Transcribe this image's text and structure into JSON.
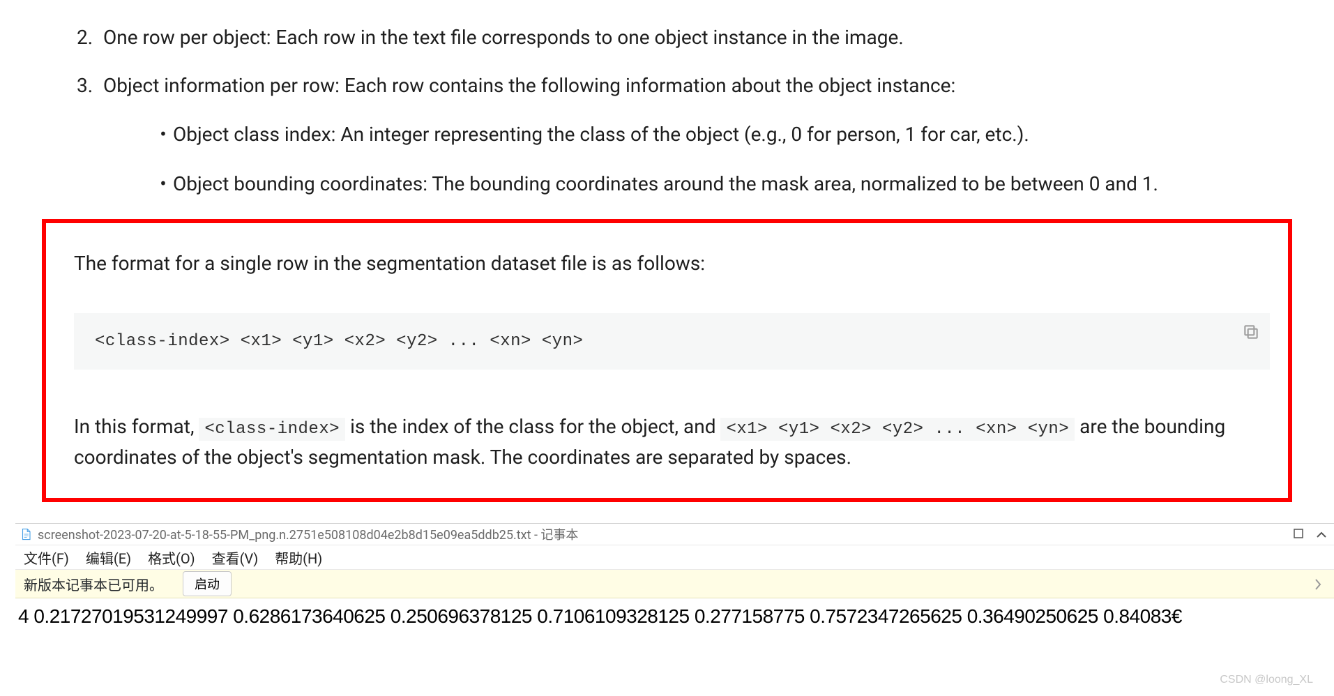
{
  "doc": {
    "list2_num": "2.",
    "list2_text": "One row per object: Each row in the text file corresponds to one object instance in the image.",
    "list3_num": "3.",
    "list3_text": "Object information per row: Each row contains the following information about the object instance:",
    "bullet1": "Object class index: An integer representing the class of the object (e.g., 0 for person, 1 for car, etc.).",
    "bullet2": "Object bounding coordinates: The bounding coordinates around the mask area, normalized to be between 0 and 1.",
    "format_intro": "The format for a single row in the segmentation dataset file is as follows:",
    "code_line": "<class-index> <x1> <y1> <x2> <y2> ... <xn> <yn>",
    "explain_prefix": "In this format, ",
    "explain_code1": "<class-index>",
    "explain_mid": " is the index of the class for the object, and ",
    "explain_code2": "<x1> <y1> <x2> <y2> ... <xn> <yn>",
    "explain_suffix": " are the bounding coordinates of the object's segmentation mask. The coordinates are separated by spaces."
  },
  "notepad": {
    "title": "screenshot-2023-07-20-at-5-18-55-PM_png.n.2751e508108d04e2b8d15e09ea5ddb25.txt - 记事本",
    "menu": {
      "file": "文件(F)",
      "edit": "编辑(E)",
      "format": "格式(O)",
      "view": "查看(V)",
      "help": "帮助(H)"
    },
    "banner_text": "新版本记事本已可用。",
    "banner_button": "启动",
    "content": "4 0.21727019531249997 0.6286173640625 0.250696378125 0.7106109328125 0.277158775 0.7572347265625 0.36490250625 0.84083€"
  },
  "watermark": "CSDN @loong_XL"
}
